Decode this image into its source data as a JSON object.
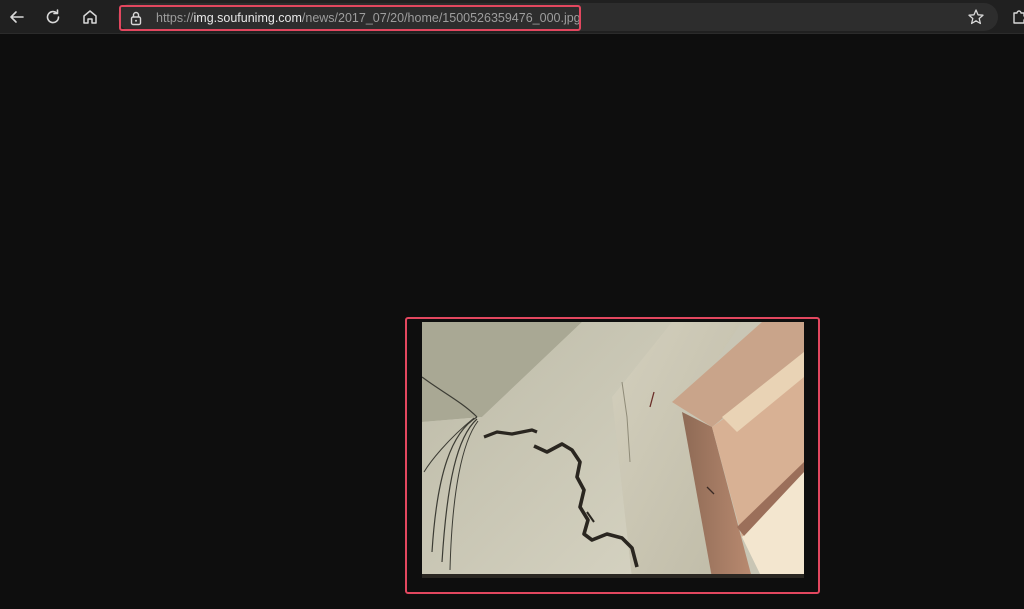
{
  "browser": {
    "url_scheme": "https://",
    "url_host": "img.soufunimg.com",
    "url_path": "/news/2017_07/20/home/1500526359476_000.jpg",
    "icons": {
      "back": "back-arrow-icon",
      "refresh": "refresh-icon",
      "home": "home-icon",
      "lock": "lock-icon",
      "favorite": "star-icon",
      "extensions": "puzzle-icon"
    }
  },
  "viewer": {
    "background": "#0e0e0e",
    "image_subject": "cracked-wall-photo"
  },
  "colors": {
    "highlight": "#e2475f",
    "toolbar": "#202020"
  }
}
